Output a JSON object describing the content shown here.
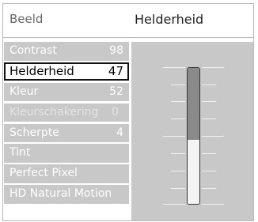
{
  "header": {
    "menu_label": "Beeld",
    "title": "Helderheid"
  },
  "menu": {
    "items": [
      {
        "label": "Contrast",
        "value": "98",
        "state": "normal"
      },
      {
        "label": "Helderheid",
        "value": "47",
        "state": "selected"
      },
      {
        "label": "Kleur",
        "value": "52",
        "state": "normal"
      },
      {
        "label": "Kleurschakering",
        "value": "0",
        "state": "disabled"
      },
      {
        "label": "Scherpte",
        "value": "4",
        "state": "normal"
      },
      {
        "label": "Tint",
        "value": "",
        "state": "normal"
      },
      {
        "label": "Perfect Pixel",
        "value": "",
        "state": "normal"
      },
      {
        "label": "HD Natural Motion",
        "value": "",
        "state": "normal"
      }
    ]
  },
  "slider": {
    "level_fraction": 0.47
  },
  "colors": {
    "row_background": "#c8c8c8",
    "panel_background": "#c8c8c8",
    "row_text": "#ffffff",
    "selected_border": "#111111"
  }
}
